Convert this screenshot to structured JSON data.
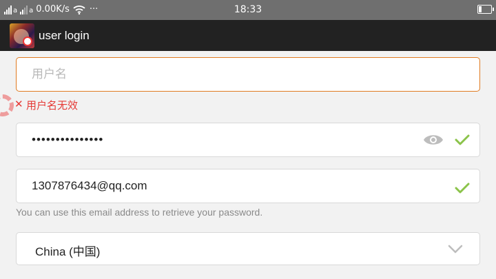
{
  "statusbar": {
    "left_small_1": "a",
    "left_small_2": "a",
    "speed": "0.00K/s",
    "more": "···",
    "time": "18:33"
  },
  "appbar": {
    "title": "user login",
    "icon": "game-app-icon"
  },
  "form": {
    "username": {
      "value": "",
      "placeholder": "用户名",
      "error_icon": "close-icon",
      "error": "用户名无效"
    },
    "password": {
      "value": "•••••••••••••••",
      "visibility_icon": "eye-icon",
      "valid_icon": "check-icon"
    },
    "email": {
      "value": "1307876434@qq.com",
      "valid_icon": "check-icon",
      "hint": "You can use this email address to retrieve your password."
    },
    "country": {
      "value": "China (中国)",
      "icon": "chevron-down-icon"
    }
  },
  "colors": {
    "focus_border": "#e07a1f",
    "error": "#e53935",
    "valid": "#8bc34a",
    "appbar": "#222222",
    "statusbar": "#6f6f6f"
  }
}
